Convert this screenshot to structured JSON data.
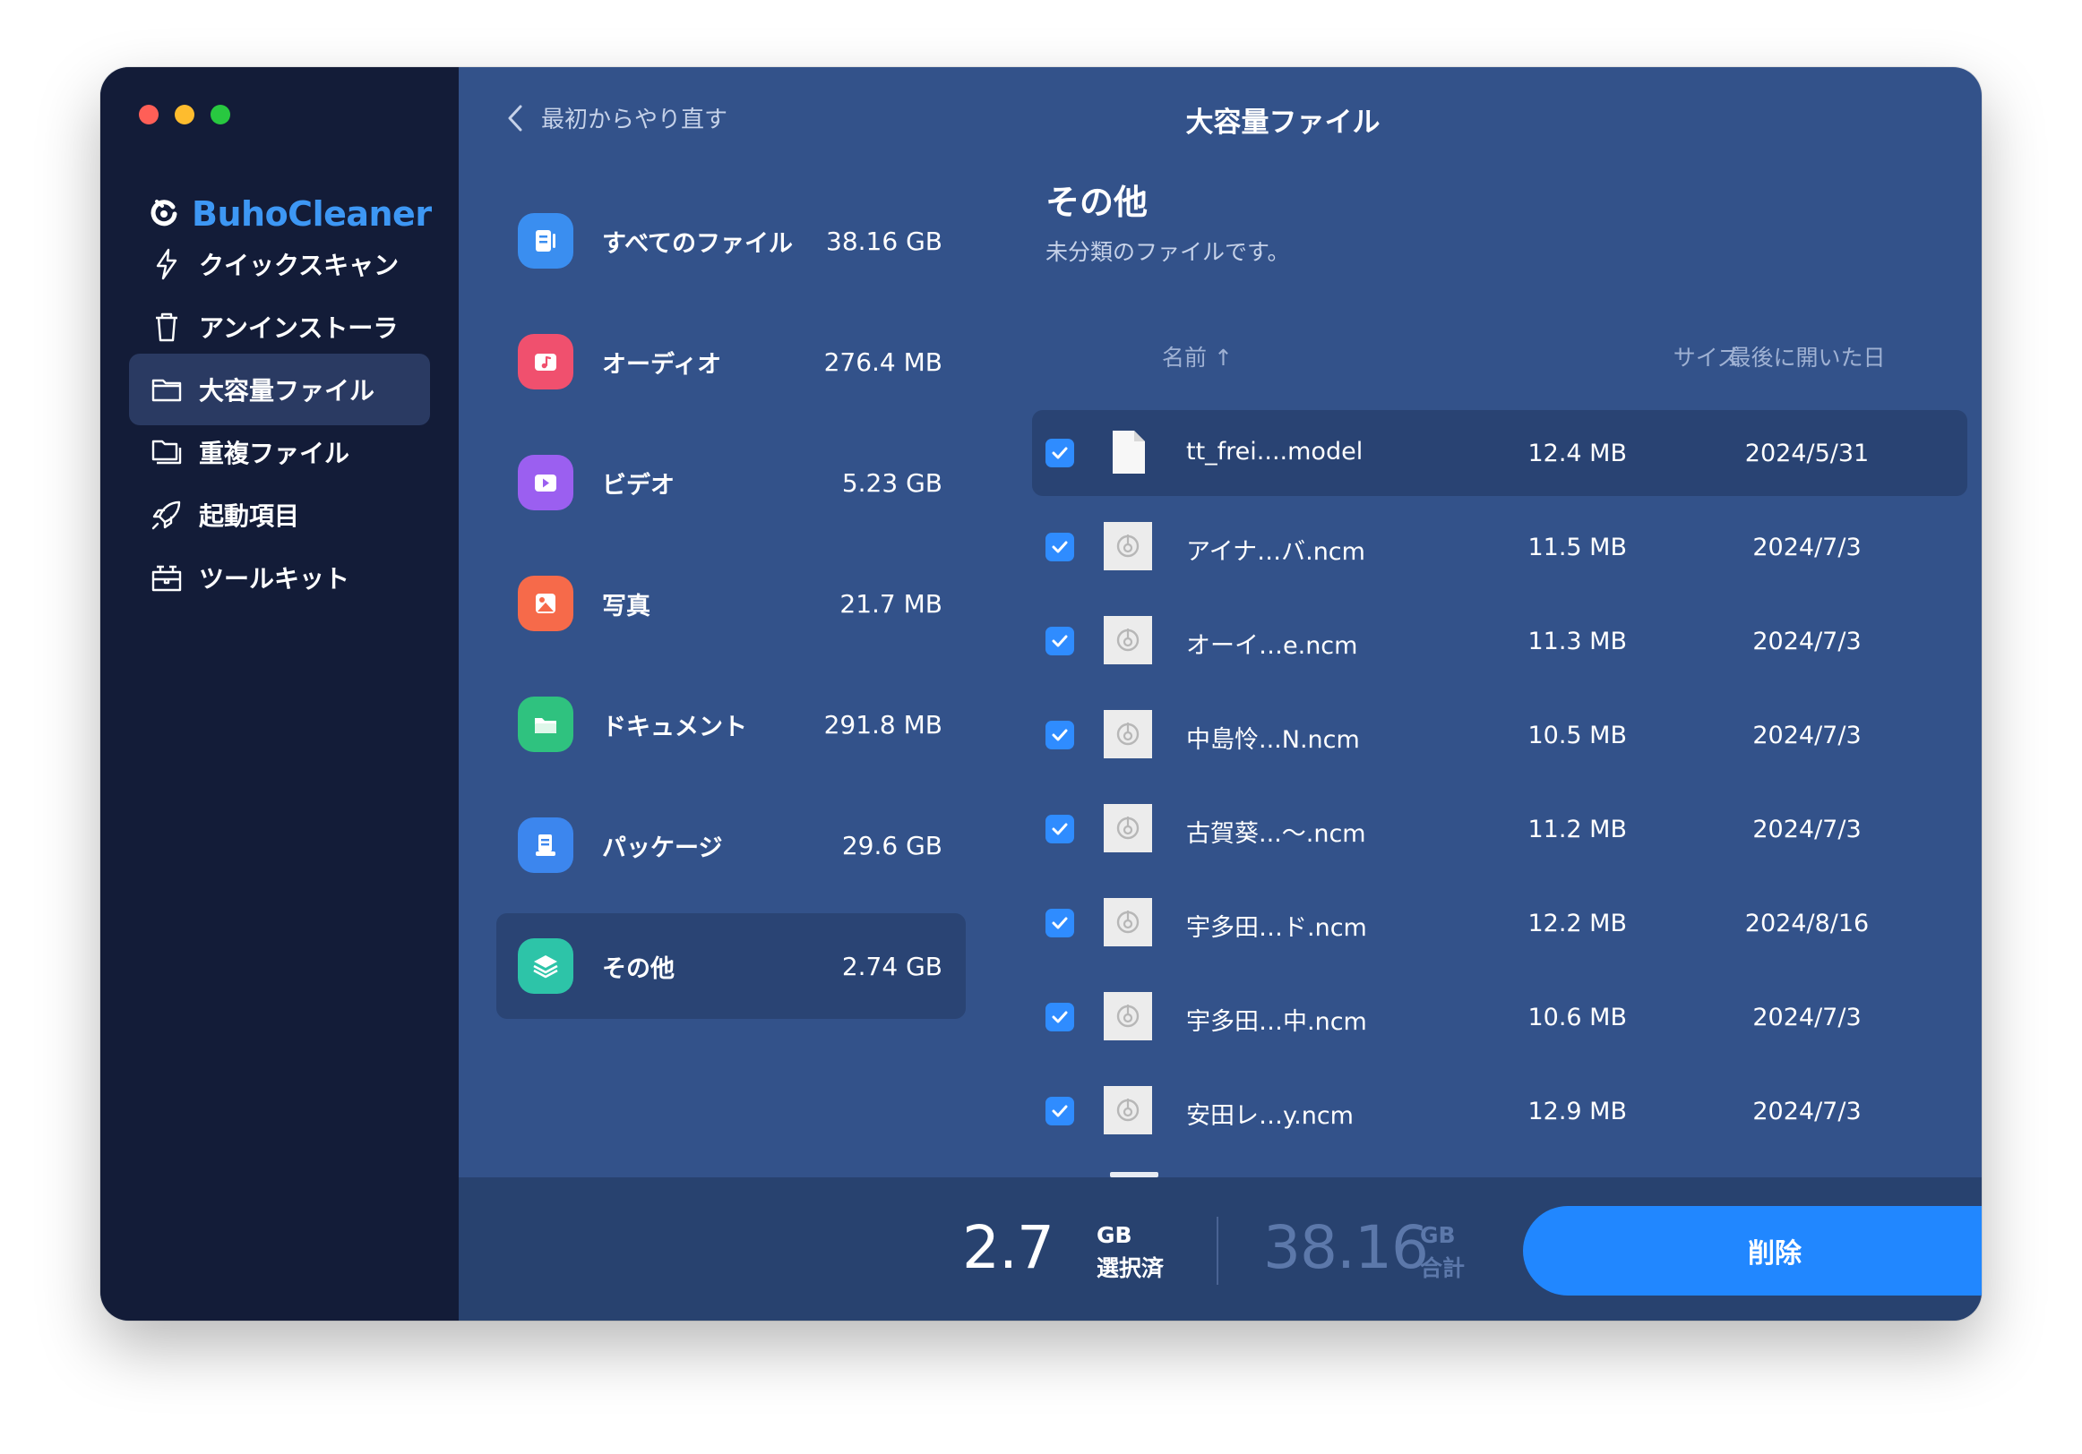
{
  "app": {
    "name": "BuhoCleaner"
  },
  "sidebar": {
    "items": [
      {
        "label": "クイックスキャン",
        "icon": "lightning-icon"
      },
      {
        "label": "アンインストーラ",
        "icon": "trash-icon"
      },
      {
        "label": "大容量ファイル",
        "icon": "folder-icon",
        "active": true
      },
      {
        "label": "重複ファイル",
        "icon": "duplicate-folder-icon"
      },
      {
        "label": "起動項目",
        "icon": "rocket-icon"
      },
      {
        "label": "ツールキット",
        "icon": "toolbox-icon"
      }
    ]
  },
  "header": {
    "back_label": "最初からやり直す",
    "title": "大容量ファイル"
  },
  "categories": [
    {
      "label": "すべてのファイル",
      "size": "38.16 GB",
      "color": "#3a8ef0"
    },
    {
      "label": "オーディオ",
      "size": "276.4 MB",
      "color": "#f0506e"
    },
    {
      "label": "ビデオ",
      "size": "5.23 GB",
      "color": "#9b5ff0"
    },
    {
      "label": "写真",
      "size": "21.7 MB",
      "color": "#f66a4a"
    },
    {
      "label": "ドキュメント",
      "size": "291.8 MB",
      "color": "#2fc27f"
    },
    {
      "label": "パッケージ",
      "size": "29.6 GB",
      "color": "#3c86ee"
    },
    {
      "label": "その他",
      "size": "2.74 GB",
      "color": "#2dc4a8",
      "active": true
    }
  ],
  "details": {
    "title": "その他",
    "description": "未分類のファイルです。",
    "columns": {
      "name": "名前 ↑",
      "size": "サイズ",
      "date": "最後に開いた日"
    },
    "files": [
      {
        "name": "tt_frei....model",
        "size": "12.4 MB",
        "date": "2024/5/31",
        "checked": true
      },
      {
        "name": "アイナ…バ.ncm",
        "size": "11.5 MB",
        "date": "2024/7/3",
        "checked": true
      },
      {
        "name": "オーイ…e.ncm",
        "size": "11.3 MB",
        "date": "2024/7/3",
        "checked": true
      },
      {
        "name": "中島怜...N.ncm",
        "size": "10.5 MB",
        "date": "2024/7/3",
        "checked": true
      },
      {
        "name": "古賀葵...〜.ncm",
        "size": "11.2 MB",
        "date": "2024/7/3",
        "checked": true
      },
      {
        "name": "宇多田…ド.ncm",
        "size": "12.2 MB",
        "date": "2024/8/16",
        "checked": true
      },
      {
        "name": "宇多田…中.ncm",
        "size": "10.6 MB",
        "date": "2024/7/3",
        "checked": true
      },
      {
        "name": "安田レ…y.ncm",
        "size": "12.9 MB",
        "date": "2024/7/3",
        "checked": true
      }
    ]
  },
  "footer": {
    "selected_value": "2.7",
    "selected_unit": "GB",
    "selected_label": "選択済",
    "total_value": "38.16",
    "total_unit": "GB",
    "total_label": "合計",
    "delete_label": "削除"
  }
}
